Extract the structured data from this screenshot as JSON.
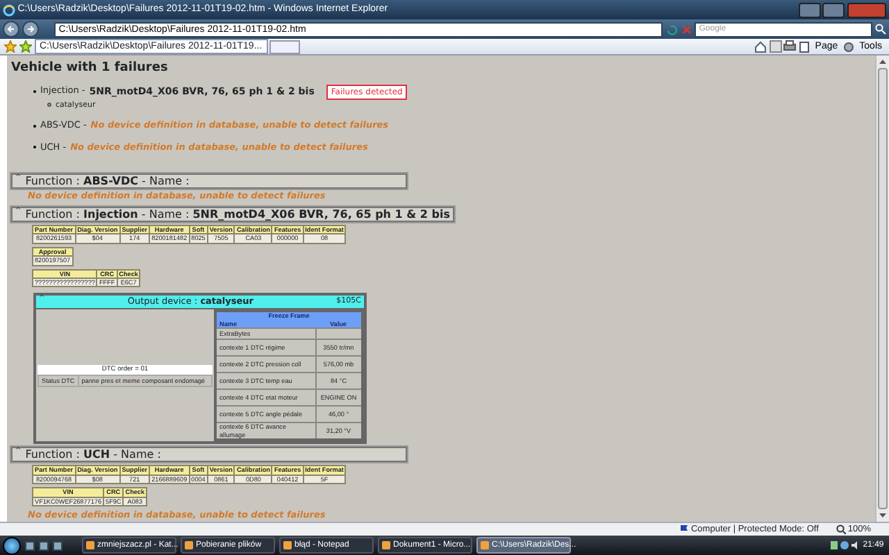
{
  "window": {
    "title": "C:\\Users\\Radzik\\Desktop\\Failures 2012-11-01T19-02.htm - Windows Internet Explorer"
  },
  "address_bar": {
    "value": "C:\\Users\\Radzik\\Desktop\\Failures 2012-11-01T19-02.htm",
    "search_placeholder": "Google"
  },
  "tabs": [
    {
      "label": "C:\\Users\\Radzik\\Desktop\\Failures 2012-11-01T19...",
      "selected": true
    }
  ],
  "commands": [
    "Page",
    "Tools"
  ],
  "summary": {
    "heading": "Vehicle with 1 failures",
    "items": [
      {
        "device": "Injection - ",
        "detail": "5NR_motD4_X06 BVR, 76, 65 ph 1 & 2 bis",
        "kind": "ok",
        "badge": "Failures detected",
        "children": [
          "catalyseur"
        ]
      },
      {
        "device": "ABS-VDC - ",
        "detail": "No device definition in database, unable to detect failures",
        "kind": "warning"
      },
      {
        "device": "UCH - ",
        "detail": "No device definition in database, unable to detect failures",
        "kind": "warning"
      }
    ]
  },
  "functions": [
    {
      "toggle": "^",
      "header": "Function : **ABS-VDC** - Name :",
      "message": "No device definition in database, unable to detect failures"
    },
    {
      "toggle": "^",
      "header": "Function : **Injection** - Name : **5NR_motD4_X06 BVR, 76, 65 ph 1 & 2 bis**",
      "ident_table": {
        "columns": [
          "Part Number",
          "Diag. Version",
          "Supplier",
          "Hardware",
          "Soft",
          "Version",
          "Calibration",
          "Features",
          "Ident Format"
        ],
        "rows": [
          [
            "8200261593",
            "$04",
            "174",
            "8200181482",
            "8025",
            "7505",
            "CA03",
            "000000",
            "08"
          ]
        ]
      },
      "approval_table": {
        "columns": [
          "Approval"
        ],
        "rows": [
          [
            "8200197507"
          ]
        ]
      },
      "vin_table": {
        "columns": [
          "VIN",
          "CRC",
          "Check"
        ],
        "rows": [
          [
            "?????????????????",
            "FFFF",
            "E6C7"
          ]
        ]
      },
      "output_devices": [
        {
          "toggle": "^",
          "title": "Output device : **catalyseur**",
          "code": "$105C",
          "dtc_order": "DTC order = 01",
          "status_label": "Status DTC",
          "status_value": "panne pres et meme composant endomagé",
          "freeze_frame": {
            "title": "Freeze Frame",
            "columns": [
              "Name",
              "Value"
            ],
            "rows": [
              [
                "ExtraBytes",
                ""
              ],
              [
                "contexte 1 DTC régime",
                "3550 tr/mn"
              ],
              [
                "contexte 2 DTC pression coll",
                "576,00 mb"
              ],
              [
                "contexte 3 DTC temp eau",
                "84 °C"
              ],
              [
                "contexte 4 DTC etat moteur",
                "ENGINE ON"
              ],
              [
                "contexte 5 DTC angle pédale",
                "46,00 °"
              ],
              [
                "contexte 6 DTC avance allumage",
                "31,20 °V"
              ]
            ]
          }
        }
      ]
    },
    {
      "toggle": "^",
      "header": "Function : **UCH** - Name :",
      "ident_table": {
        "columns": [
          "Part Number",
          "Diag. Version",
          "Supplier",
          "Hardware",
          "Soft",
          "Version",
          "Calibration",
          "Features",
          "Ident Format"
        ],
        "rows": [
          [
            "8200094768",
            "$08",
            "721",
            "2166889609",
            "0004",
            "0861",
            "0D80",
            "040412",
            "5F"
          ]
        ]
      },
      "vin_table": {
        "columns": [
          "VIN",
          "CRC",
          "Check"
        ],
        "rows": [
          [
            "VF1KC0WEF26877176",
            "5F9C",
            "A083"
          ]
        ]
      },
      "message": "No device definition in database, unable to detect failures"
    }
  ],
  "status_bar": {
    "zone": "Computer | Protected Mode: Off",
    "zoom": "100%"
  },
  "taskbar": {
    "items": [
      {
        "label": "zmniejszacz.pl - Kat...",
        "selected": false
      },
      {
        "label": "Pobieranie plików",
        "selected": false
      },
      {
        "label": "błąd - Notepad",
        "selected": false
      },
      {
        "label": "Dokument1 - Micro...",
        "selected": false
      },
      {
        "label": "C:\\Users\\Radzik\\Des...",
        "selected": true
      }
    ],
    "clock": "21:49"
  }
}
